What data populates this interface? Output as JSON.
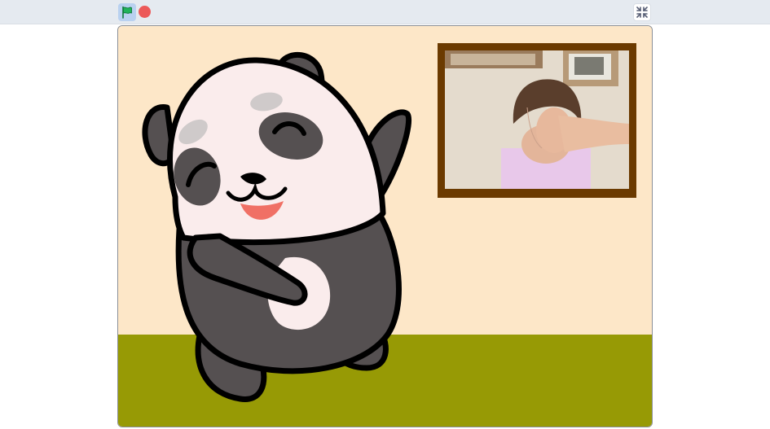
{
  "toolbar": {
    "green_flag": {
      "icon": "green-flag-icon",
      "color": "#1fb35a"
    },
    "stop": {
      "icon": "stop-icon",
      "color": "#ec5959"
    },
    "fullscreen": {
      "icon": "exit-fullscreen-icon"
    }
  },
  "stage": {
    "background_color": "#fde7c8",
    "ground_color": "#979a05",
    "sprite": "panda-sprite",
    "video_frame": {
      "frame_color": "#6b3a00",
      "content": "webcam-video-feed"
    }
  }
}
